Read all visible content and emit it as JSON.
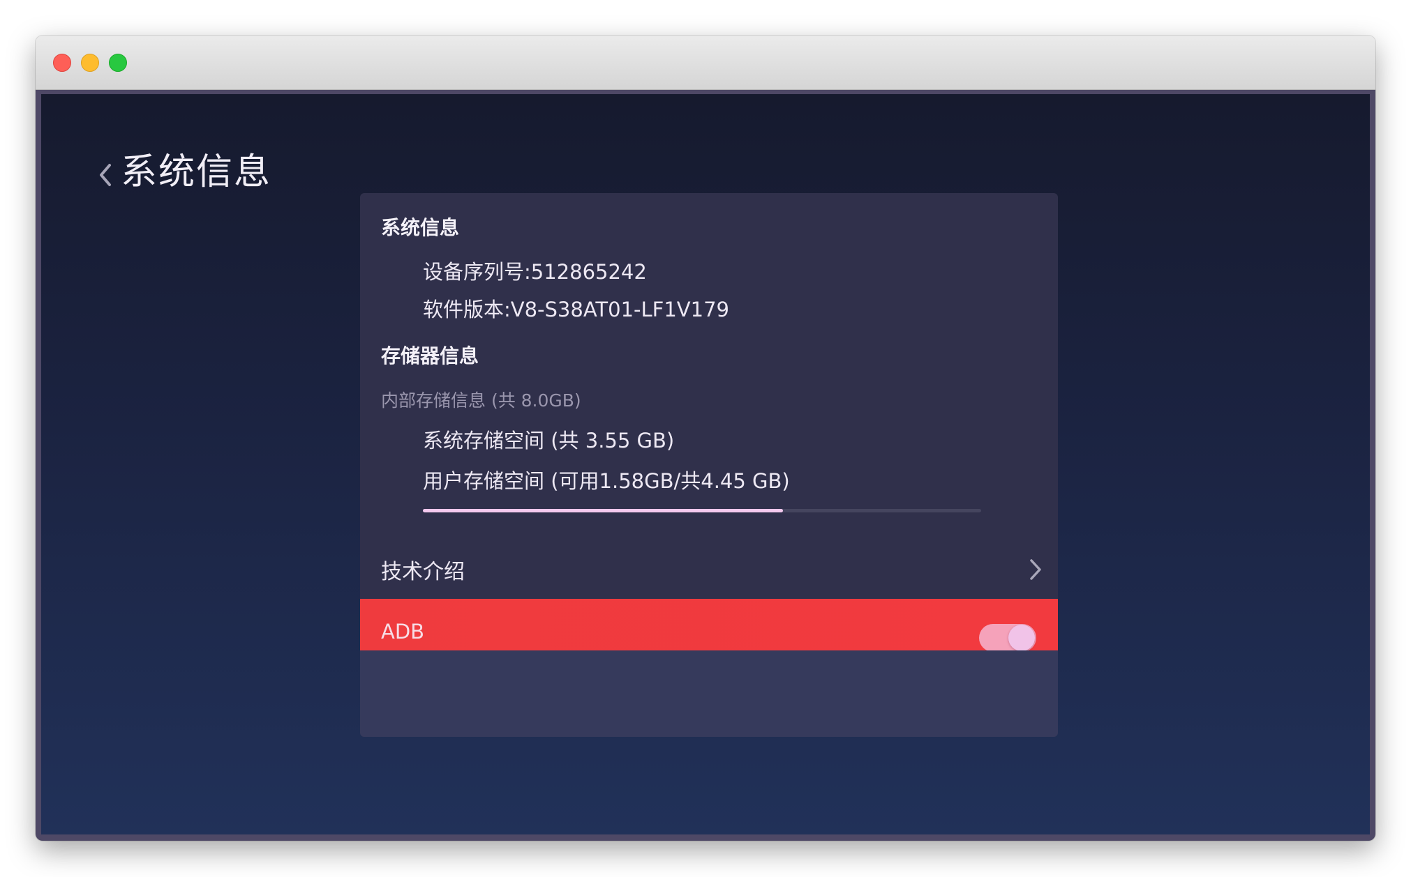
{
  "window": {
    "controls": [
      "close",
      "minimize",
      "maximize"
    ]
  },
  "header": {
    "back_icon": "chevron-left-icon",
    "title": "系统信息"
  },
  "system_section": {
    "title": "系统信息",
    "serial": "设备序列号:512865242",
    "version": "软件版本:V8-S38AT01-LF1V179"
  },
  "storage_section": {
    "title": "存储器信息",
    "internal_label": "内部存储信息 (共 8.0GB)",
    "system_storage": "系统存储空间 (共 3.55 GB)",
    "user_storage": "用户存储空间 (可用1.58GB/共4.45 GB)",
    "user_storage_used_fraction": 0.645,
    "progress_fill_color": "#f4c9ee"
  },
  "tech_intro": {
    "label": "技术介绍",
    "icon": "chevron-right-icon"
  },
  "adb": {
    "label": "ADB",
    "enabled": true,
    "highlight_color": "#f23a3f"
  }
}
